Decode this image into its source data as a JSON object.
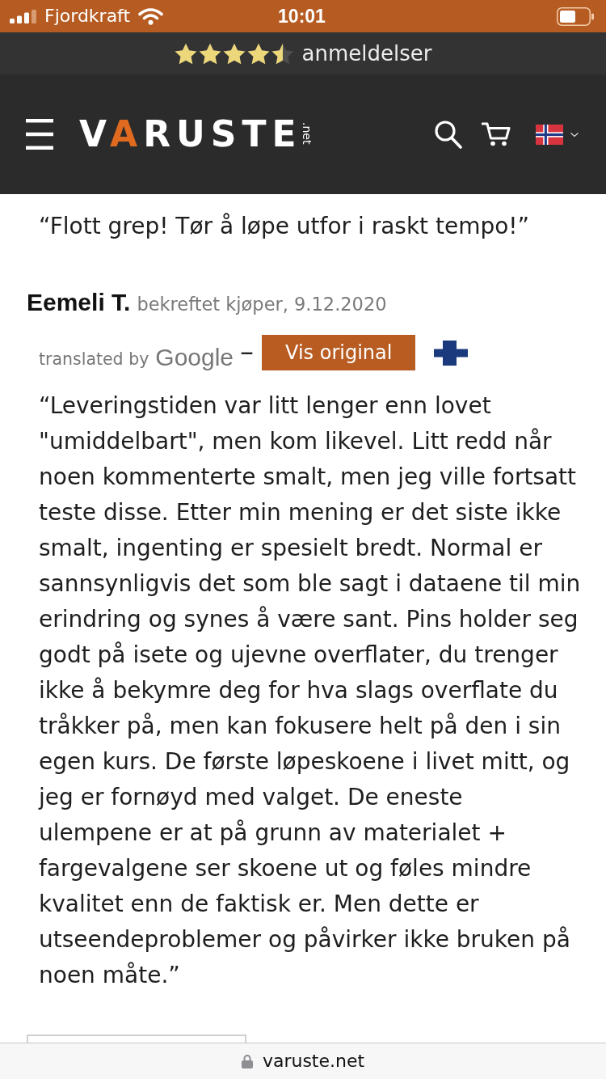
{
  "status_bar": {
    "carrier": "Fjordkraft",
    "time": "10:01"
  },
  "rating_bar": {
    "stars": 4.5,
    "label": "anmeldelser"
  },
  "header": {
    "logo": {
      "name": "VARUSTE",
      "suffix": ".net"
    }
  },
  "review": {
    "title": "“Flott grep! Tør å løpe utfor i raskt tempo!”",
    "author": "Eemeli T.",
    "meta": "bekreftet kjøper, 9.12.2020",
    "translation": {
      "label": "translated by",
      "provider": "Google",
      "separator": "–",
      "button": "Vis original"
    },
    "body": "“Leveringstiden var litt lenger enn lovet \"umiddelbart\", men kom likevel. Litt redd når noen kommenterte smalt, men jeg ville fortsatt teste disse. Etter min mening er det siste ikke smalt, ingenting er spesielt bredt. Normal er sannsynligvis det som ble sagt i dataene til min erindring og synes å være sant. Pins holder seg godt på isete og ujevne overflater, du trenger ikke å bekymre deg for hva slags overflate du tråkker på, men kan fokusere helt på den i sin egen kurs. De første løpeskoene i livet mitt, og jeg er fornøyd med valget. De eneste ulempene er at på grunn av materialet + fargevalgene ser skoene ut og føles mindre kvalitet enn de faktisk er. Men dette er utseendeproblemer og påvirker ikke bruken på noen måte.”"
  },
  "browser_bar": {
    "url": "varuste.net"
  }
}
